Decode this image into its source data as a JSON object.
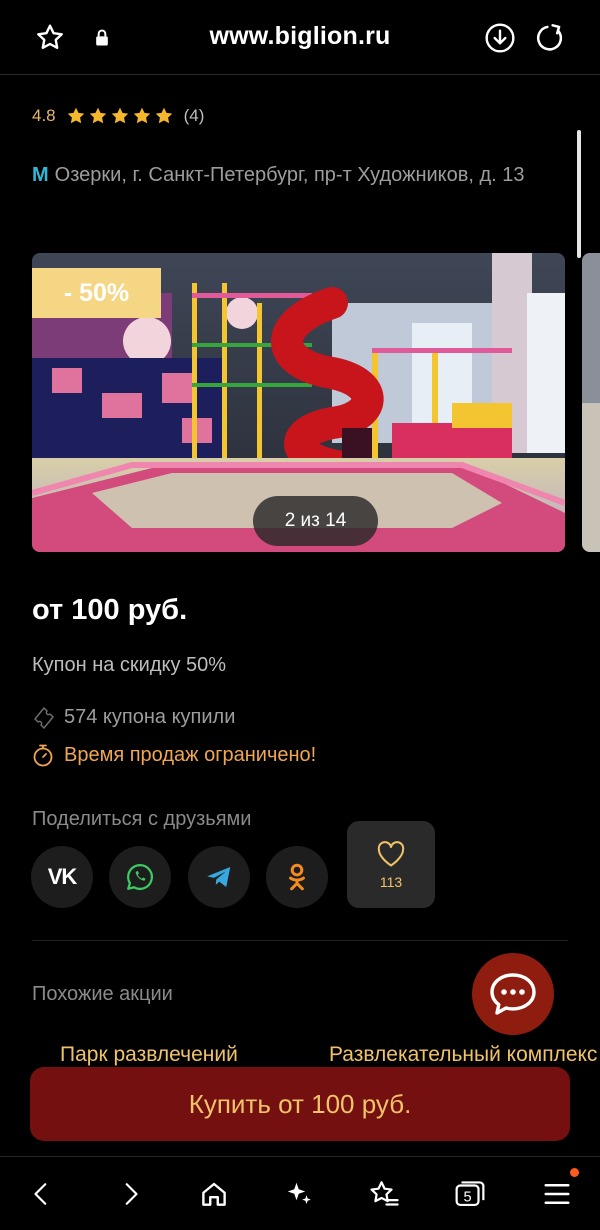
{
  "browser": {
    "url": "www.biglion.ru",
    "icons": [
      "star-outline-icon",
      "lock-icon",
      "download-icon",
      "refresh-icon"
    ]
  },
  "rating": {
    "score": "4.8",
    "stars": 5,
    "count": "(4)",
    "star_color": "#f4b72e"
  },
  "address": {
    "metro_symbol": "M",
    "text": "Озерки, г. Санкт-Петербург, пр-т Художников, д. 13"
  },
  "gallery": {
    "discount": "- 50%",
    "counter": "2 из 14"
  },
  "offer": {
    "price": "от 100 руб.",
    "subtitle": "Купон на скидку 50%",
    "coupons_bought": "574 купона купили",
    "limited": "Время продаж ограничено!"
  },
  "share": {
    "title": "Поделиться с друзьями",
    "networks": [
      "vk-icon",
      "whatsapp-icon",
      "telegram-icon",
      "odnoklassniki-icon"
    ],
    "likes": "113"
  },
  "similar": {
    "title": "Похожие акции",
    "cards": [
      "Парк развлечений",
      "Развлекательный комплекс"
    ]
  },
  "buy_button": "Купить от 100 руб.",
  "nav": {
    "tabs_count": "5",
    "icons": [
      "back-icon",
      "forward-icon",
      "home-icon",
      "sparkle-icon",
      "bookmarks-icon",
      "tabs-icon",
      "menu-icon"
    ]
  },
  "colors": {
    "accent": "#f0c36a",
    "buy_bg": "#741010",
    "chat_bg": "#8e1d0f",
    "discount_bg": "#f4d684",
    "metro": "#2fb8d6"
  }
}
